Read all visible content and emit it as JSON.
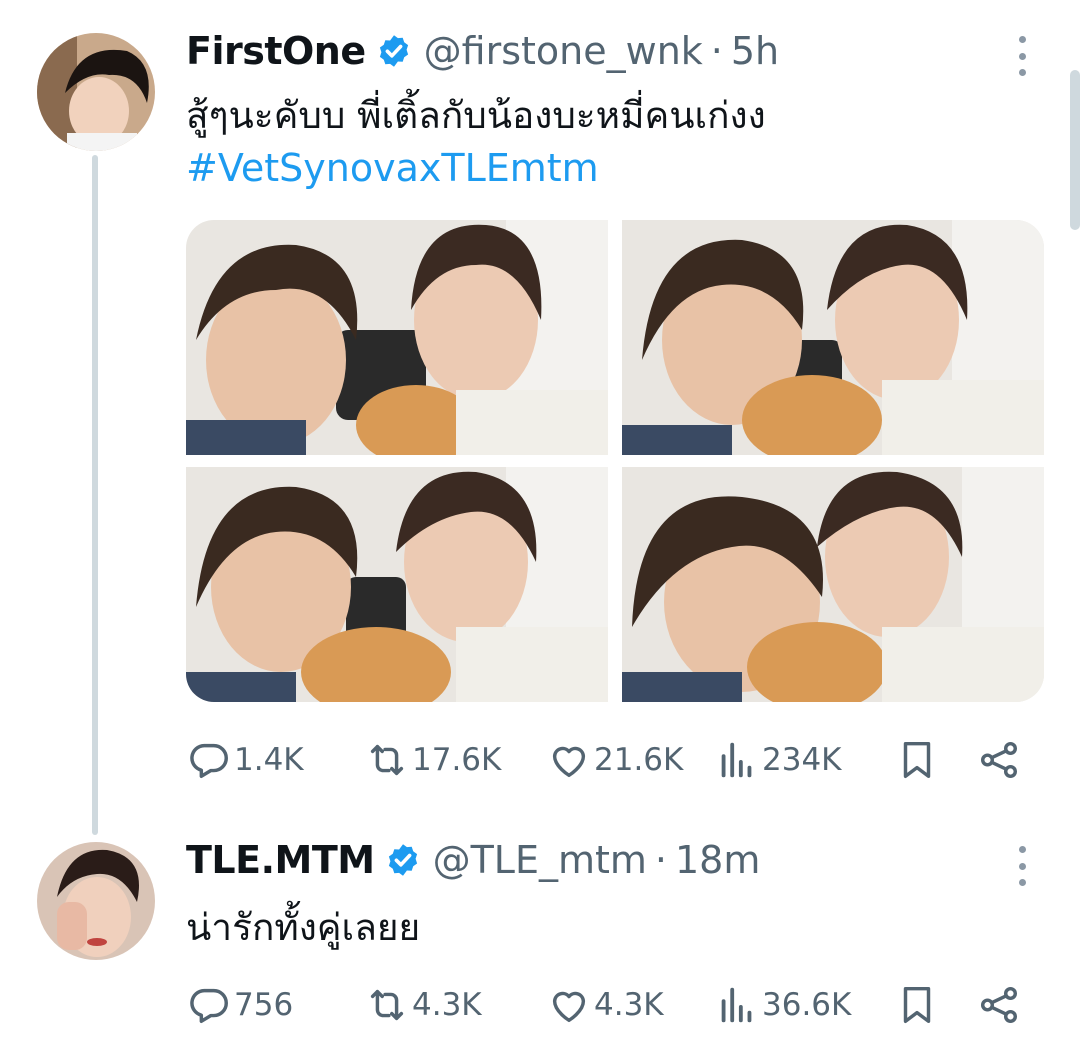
{
  "tweets": [
    {
      "display_name": "FirstOne",
      "handle": "@firstone_wnk",
      "separator": "·",
      "time": "5h",
      "text": "สู้ๆนะคับบ พี่เติ้ลกับน้องบะหมี่คนเก่งง",
      "hashtag": "#VetSynovaxTLEmtm",
      "stats": {
        "replies": "1.4K",
        "retweets": "17.6K",
        "likes": "21.6K",
        "views": "234K"
      },
      "media_count": 4
    },
    {
      "display_name": "TLE.MTM",
      "handle": "@TLE_mtm",
      "separator": "·",
      "time": "18m",
      "text": "น่ารักทั้งคู่เลยย",
      "stats": {
        "replies": "756",
        "retweets": "4.3K",
        "likes": "4.3K",
        "views": "36.6K"
      }
    }
  ],
  "icons": {
    "verified": "verified-badge-icon",
    "reply": "reply-icon",
    "retweet": "retweet-icon",
    "like": "heart-icon",
    "views": "views-icon",
    "bookmark": "bookmark-icon",
    "share": "share-icon",
    "more": "more-vertical-icon"
  },
  "colors": {
    "accent": "#1d9bf0",
    "muted": "#536471",
    "thread_line": "#cfd9de"
  }
}
